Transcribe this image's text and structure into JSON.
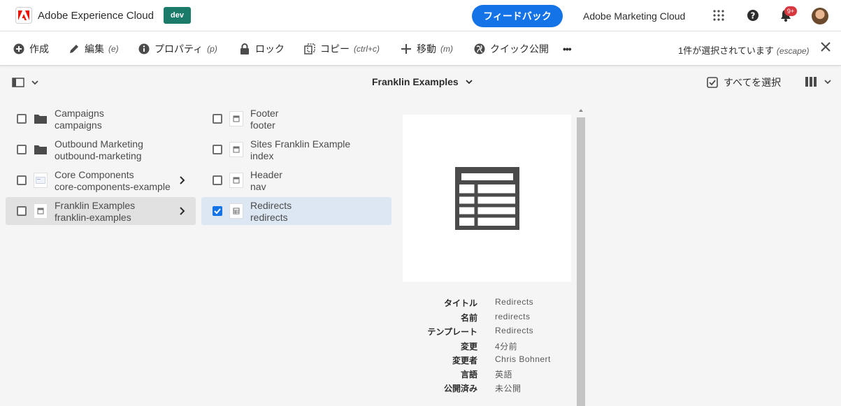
{
  "shell": {
    "app_title": "Adobe Experience Cloud",
    "env_badge": "dev",
    "feedback_label": "フィードバック",
    "org_name": "Adobe Marketing Cloud",
    "notification_count": "9+",
    "icons": [
      "adobe-logo-icon",
      "app-grid-icon",
      "help-icon",
      "bell-icon"
    ]
  },
  "actionbar": {
    "actions": [
      {
        "label": "作成",
        "hint": "",
        "icon": "plus-circle-icon"
      },
      {
        "label": "編集",
        "hint": "(e)",
        "icon": "pencil-icon"
      },
      {
        "label": "プロパティ",
        "hint": "(p)",
        "icon": "info-icon"
      },
      {
        "label": "ロック",
        "hint": "",
        "icon": "lock-icon"
      },
      {
        "label": "コピー",
        "hint": "(ctrl+c)",
        "icon": "copy-icon"
      },
      {
        "label": "移動",
        "hint": "(m)",
        "icon": "move-icon"
      },
      {
        "label": "クイック公開",
        "hint": "",
        "icon": "globe-icon"
      },
      {
        "label": "•••",
        "hint": "",
        "icon": "more-icon"
      }
    ],
    "selection_text": "1件が選択されています",
    "selection_hint": "(escape)"
  },
  "subheader": {
    "breadcrumb": "Franklin Examples",
    "select_all": "すべてを選択"
  },
  "columns": {
    "first": [
      {
        "title": "Campaigns",
        "name": "campaigns",
        "type": "folder",
        "active": false,
        "has_children": false
      },
      {
        "title": "Outbound Marketing",
        "name": "outbound-marketing",
        "type": "folder",
        "active": false,
        "has_children": false
      },
      {
        "title": "Core Components",
        "name": "core-components-example",
        "type": "site",
        "active": false,
        "has_children": true
      },
      {
        "title": "Franklin Examples",
        "name": "franklin-examples",
        "type": "page",
        "active": true,
        "has_children": true
      }
    ],
    "second": [
      {
        "title": "Footer",
        "name": "footer",
        "type": "page",
        "selected": false
      },
      {
        "title": "Sites Franklin Example",
        "name": "index",
        "type": "page",
        "selected": false
      },
      {
        "title": "Header",
        "name": "nav",
        "type": "page",
        "selected": false
      },
      {
        "title": "Redirects",
        "name": "redirects",
        "type": "table",
        "selected": true
      }
    ]
  },
  "preview": {
    "icon": "table-icon",
    "meta": [
      {
        "label": "タイトル",
        "value": "Redirects"
      },
      {
        "label": "名前",
        "value": "redirects"
      },
      {
        "label": "テンプレート",
        "value": "Redirects"
      },
      {
        "label": "変更",
        "value": "4分前"
      },
      {
        "label": "変更者",
        "value": "Chris Bohnert"
      },
      {
        "label": "言語",
        "value": "英語"
      },
      {
        "label": "公開済み",
        "value": "未公開"
      }
    ]
  },
  "colors": {
    "accent": "#1473e6",
    "env_badge": "#1a7b6b",
    "notification": "#d7373f",
    "selected_row": "#dce7f3",
    "active_row": "#e1e1e1"
  }
}
